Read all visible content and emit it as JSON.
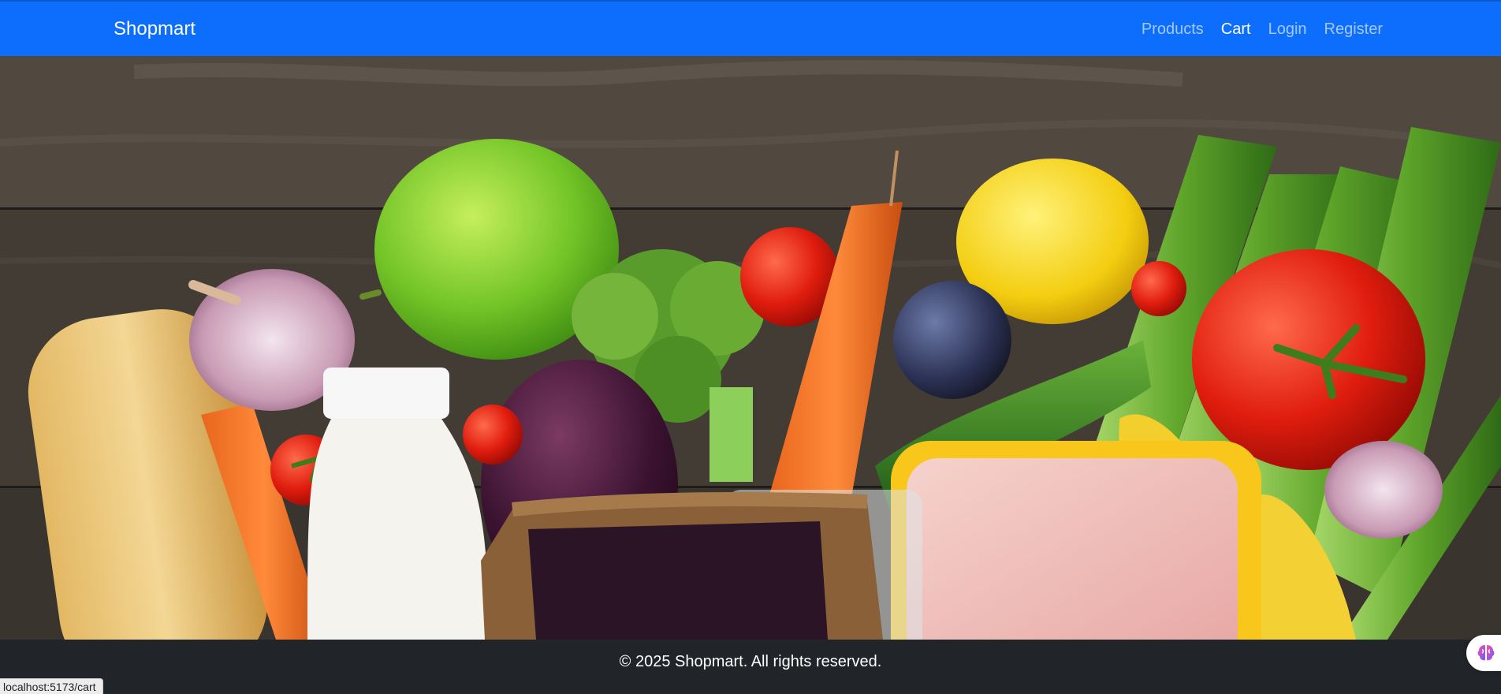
{
  "navbar": {
    "brand": "Shopmart",
    "links": [
      {
        "label": "Products",
        "active": false
      },
      {
        "label": "Cart",
        "active": true
      },
      {
        "label": "Login",
        "active": false
      },
      {
        "label": "Register",
        "active": false
      }
    ]
  },
  "footer": {
    "text": "© 2025 Shopmart. All rights reserved."
  },
  "status_bar": {
    "url": "localhost:5173/cart"
  },
  "hero": {
    "icon": "groceries-image"
  },
  "floating_button": {
    "icon": "brain-icon"
  },
  "colors": {
    "navbar": "#0d6efd",
    "footer": "#212529"
  }
}
